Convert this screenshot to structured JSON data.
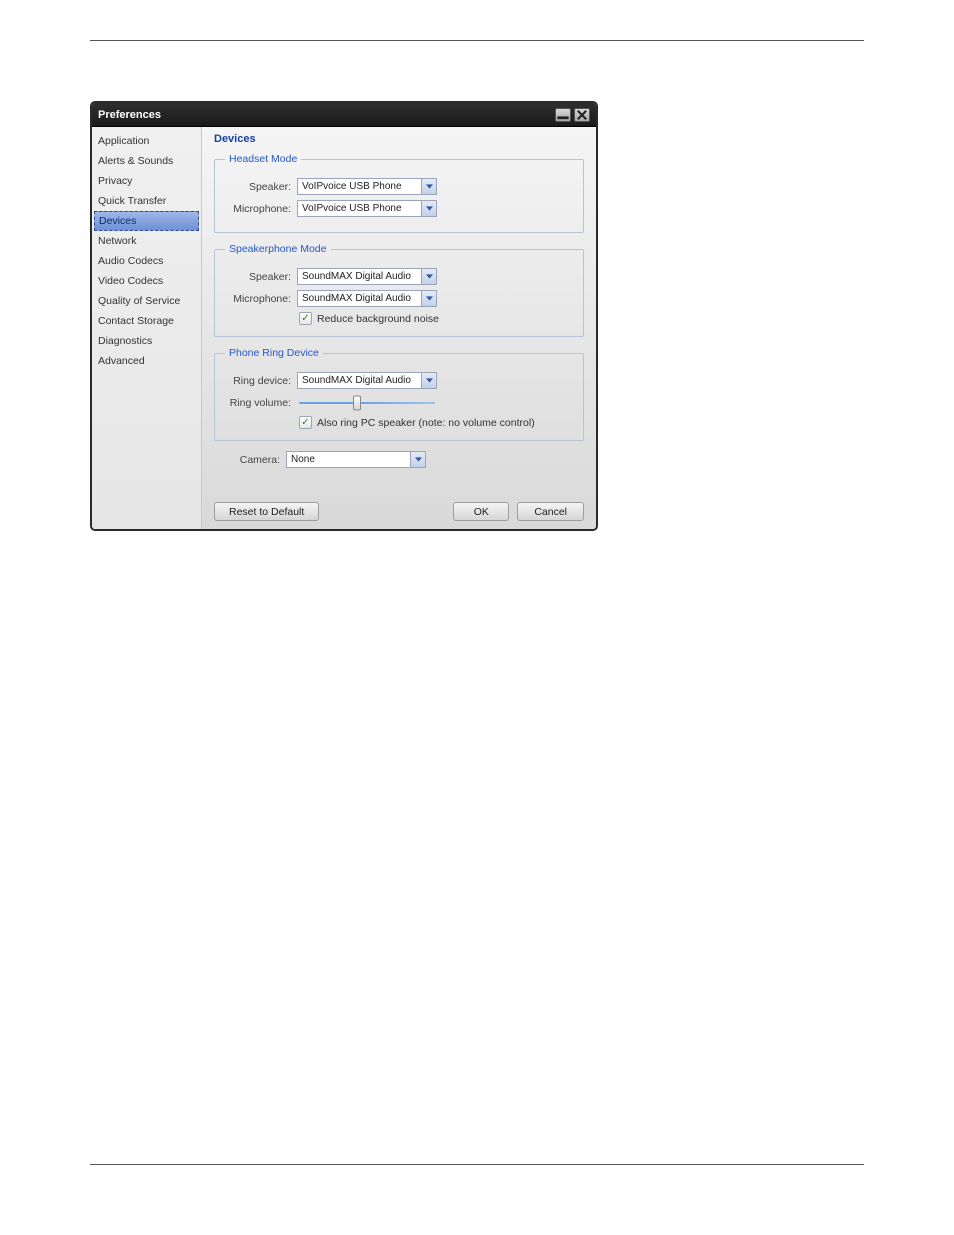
{
  "window": {
    "title": "Preferences"
  },
  "sidebar": {
    "items": [
      {
        "label": "Application"
      },
      {
        "label": "Alerts & Sounds"
      },
      {
        "label": "Privacy"
      },
      {
        "label": "Quick Transfer"
      },
      {
        "label": "Devices"
      },
      {
        "label": "Network"
      },
      {
        "label": "Audio Codecs"
      },
      {
        "label": "Video Codecs"
      },
      {
        "label": "Quality of Service"
      },
      {
        "label": "Contact Storage"
      },
      {
        "label": "Diagnostics"
      },
      {
        "label": "Advanced"
      }
    ],
    "selected_index": 4
  },
  "panel": {
    "heading": "Devices",
    "headset": {
      "legend": "Headset Mode",
      "speaker_label": "Speaker:",
      "speaker_value": "VoIPvoice USB Phone",
      "microphone_label": "Microphone:",
      "microphone_value": "VoIPvoice USB Phone"
    },
    "speakerphone": {
      "legend": "Speakerphone Mode",
      "speaker_label": "Speaker:",
      "speaker_value": "SoundMAX Digital Audio",
      "microphone_label": "Microphone:",
      "microphone_value": "SoundMAX Digital Audio",
      "reduce_noise_label": "Reduce background noise",
      "reduce_noise_checked": true
    },
    "ring": {
      "legend": "Phone Ring Device",
      "ring_device_label": "Ring device:",
      "ring_device_value": "SoundMAX Digital Audio",
      "ring_volume_label": "Ring volume:",
      "ring_volume_value": 45,
      "also_ring_label": "Also ring PC speaker (note: no volume control)",
      "also_ring_checked": true
    },
    "camera": {
      "label": "Camera:",
      "value": "None"
    }
  },
  "buttons": {
    "reset": "Reset to Default",
    "ok": "OK",
    "cancel": "Cancel"
  }
}
